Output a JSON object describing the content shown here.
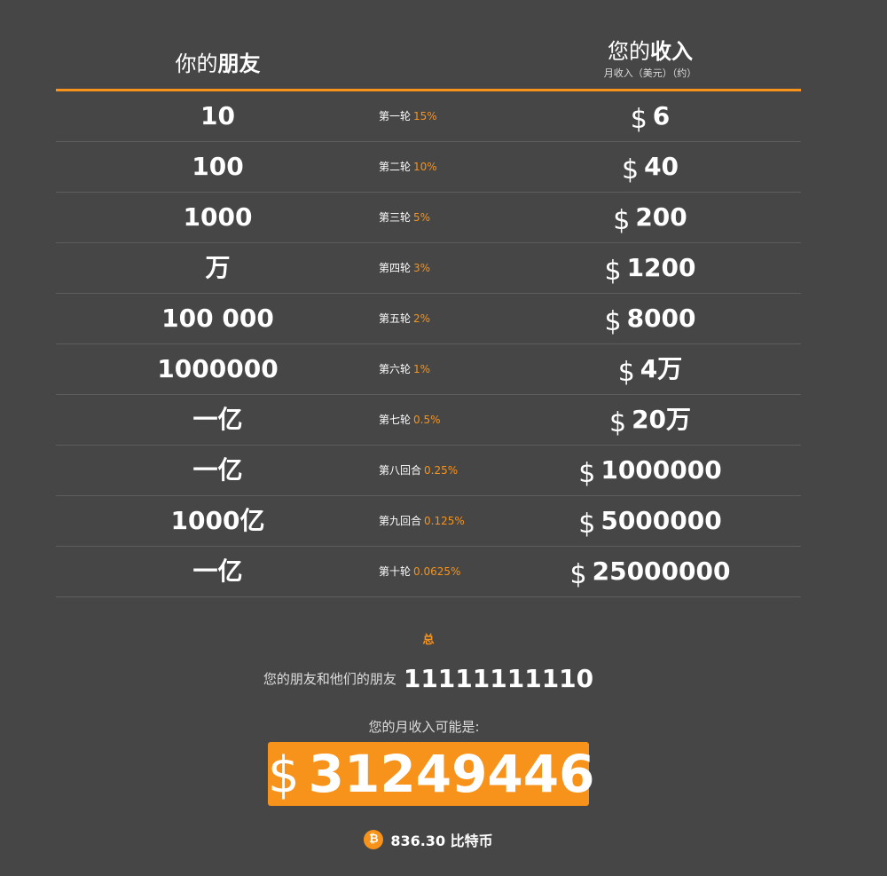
{
  "header": {
    "friends_prefix": "你的",
    "friends_bold": "朋友",
    "income_prefix": "您的",
    "income_bold": "收入",
    "income_sub": "月收入（美元）（约）"
  },
  "currency_symbol": "$",
  "rows": [
    {
      "friends": "10",
      "level": "第一轮",
      "pct": "15%",
      "income": "6"
    },
    {
      "friends": "100",
      "level": "第二轮",
      "pct": "10%",
      "income": "40"
    },
    {
      "friends": "1000",
      "level": "第三轮",
      "pct": "5%",
      "income": "200"
    },
    {
      "friends": "万",
      "level": "第四轮",
      "pct": "3%",
      "income": "1200"
    },
    {
      "friends": "100 000",
      "level": "第五轮",
      "pct": "2%",
      "income": "8000"
    },
    {
      "friends": "1000000",
      "level": "第六轮",
      "pct": "1%",
      "income": "4万"
    },
    {
      "friends": "一亿",
      "level": "第七轮",
      "pct": "0.5%",
      "income": "20万"
    },
    {
      "friends": "一亿",
      "level": "第八回合",
      "pct": "0.25%",
      "income": "1000000"
    },
    {
      "friends": "1000亿",
      "level": "第九回合",
      "pct": "0.125%",
      "income": "5000000"
    },
    {
      "friends": "一亿",
      "level": "第十轮",
      "pct": "0.0625%",
      "income": "25000000"
    }
  ],
  "totals": {
    "label": "总",
    "friends_label": "您的朋友和他们的朋友",
    "friends_value": "11111111110",
    "income_label": "您的月收入可能是:",
    "income_value": "31249446",
    "btc_symbol": "₿",
    "btc_value": "836.30 比特币"
  },
  "colors": {
    "background": "#464646",
    "accent": "#f7931a",
    "divider": "#5e5e5e"
  }
}
